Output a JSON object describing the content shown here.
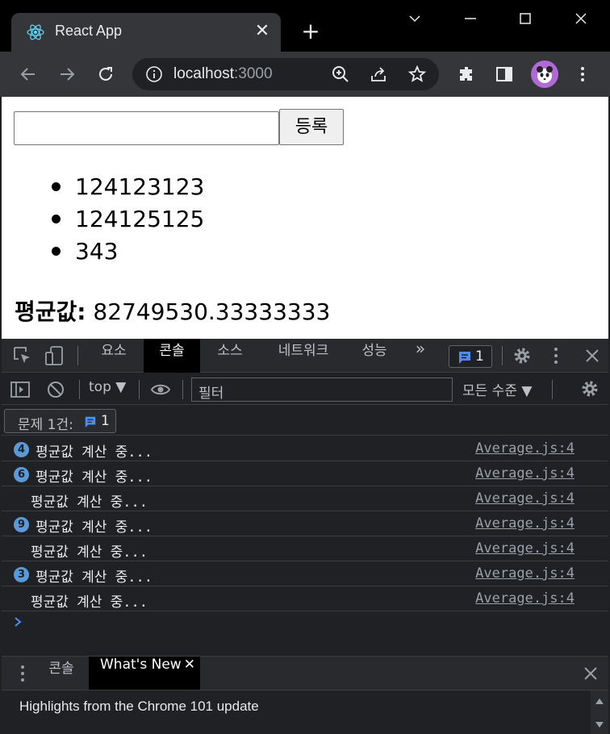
{
  "browser": {
    "tab_title": "React App",
    "url_host": "localhost",
    "url_port": ":3000"
  },
  "page": {
    "input_value": "",
    "register_label": "등록",
    "items": [
      "124123123",
      "124125125",
      "343"
    ],
    "average_label": "평균값:",
    "average_value": "82749530.33333333"
  },
  "devtools": {
    "tabs": [
      "요소",
      "콘솔",
      "소스",
      "네트워크",
      "성능"
    ],
    "active_tab": "콘솔",
    "more_tabs": "»",
    "issue_count": "1",
    "context": "top",
    "filter_placeholder": "필터",
    "levels": "모든 수준",
    "issues_label": "문제 1건:",
    "issues_count": "1",
    "logs": [
      {
        "count": "4",
        "message": "평균값 계산 중...",
        "source": "Average.js:4"
      },
      {
        "count": "6",
        "message": "평균값 계산 중...",
        "source": "Average.js:4"
      },
      {
        "count": "",
        "message": "평균값 계산 중...",
        "source": "Average.js:4"
      },
      {
        "count": "9",
        "message": "평균값 계산 중...",
        "source": "Average.js:4"
      },
      {
        "count": "",
        "message": "평균값 계산 중...",
        "source": "Average.js:4"
      },
      {
        "count": "3",
        "message": "평균값 계산 중...",
        "source": "Average.js:4"
      },
      {
        "count": "",
        "message": "평균값 계산 중...",
        "source": "Average.js:4"
      }
    ],
    "drawer_tabs": [
      "콘솔",
      "What's New"
    ],
    "drawer_active": "What's New",
    "whats_new_text": "Highlights from the Chrome 101 update"
  },
  "colors": {
    "accent_blue": "#5a9ad8",
    "badge_blue": "#4c8df6"
  }
}
